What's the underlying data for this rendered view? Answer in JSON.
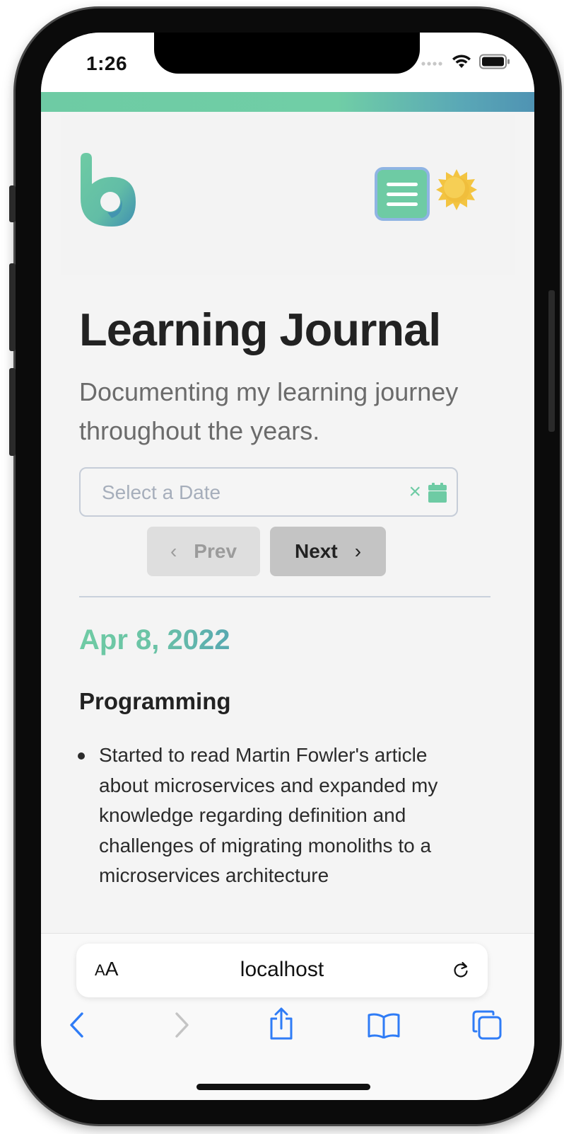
{
  "status_bar": {
    "time": "1:26"
  },
  "site": {
    "logo_icon": "brand-b-logo",
    "menu_icon": "hamburger-icon",
    "theme_icon": "sun-icon",
    "accent_color": "#6ecba4"
  },
  "page": {
    "title": "Learning Journal",
    "subtitle": "Documenting my learning journey throughout the years."
  },
  "date_picker": {
    "placeholder": "Select a Date",
    "clear_icon": "×"
  },
  "pagination": {
    "prev_label": "Prev",
    "prev_chevron": "‹",
    "next_label": "Next",
    "next_chevron": "›"
  },
  "entry": {
    "date": "Apr 8, 2022",
    "category": "Programming",
    "items": [
      "Started to read Martin Fowler's article about microservices and expanded my knowledge regarding definition and challenges of migrating monoliths to a microservices architecture"
    ]
  },
  "browser": {
    "reader_small": "A",
    "reader_large": "A",
    "url": "localhost",
    "tint_color": "#2f7cf6"
  }
}
